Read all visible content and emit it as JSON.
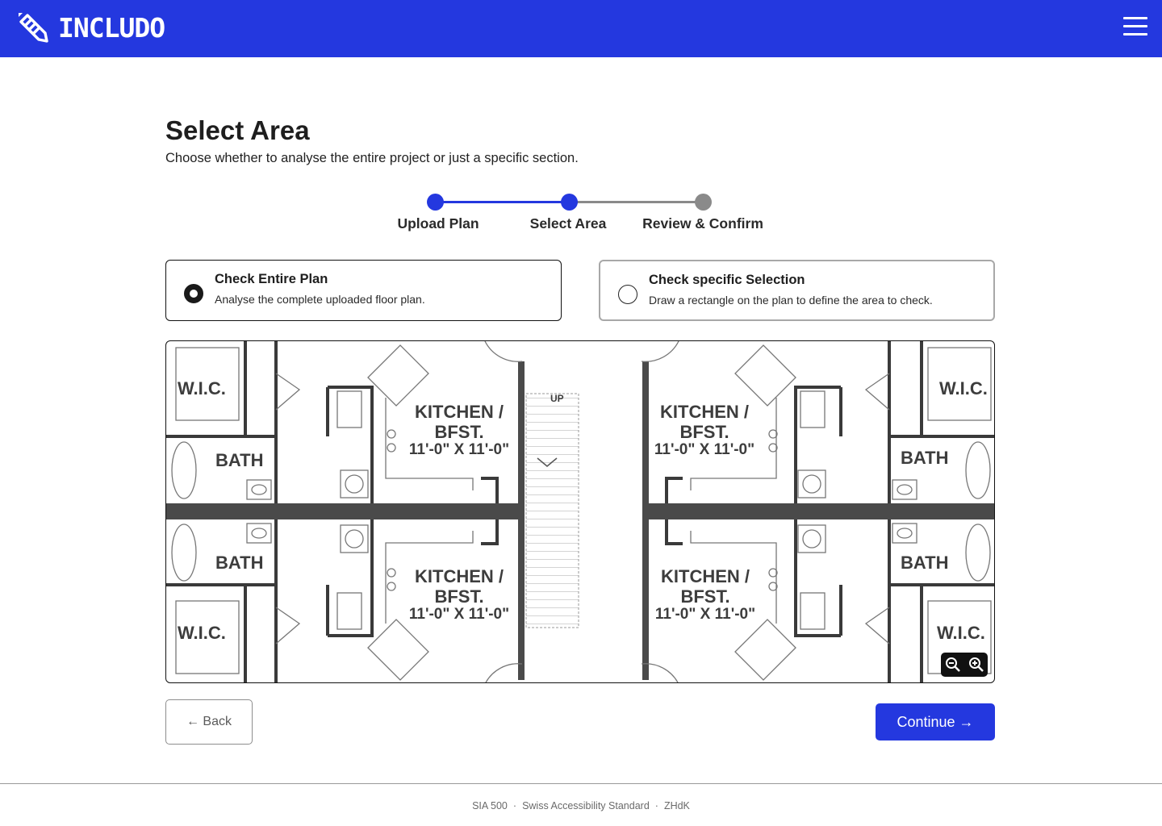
{
  "header": {
    "logo_text": "INCLUDO",
    "menu_icon": "hamburger-menu-icon",
    "background": "#2438df"
  },
  "page": {
    "title": "Select Area",
    "subtitle": "Choose whether to analyse the entire project or just a specific section."
  },
  "stepper": {
    "steps": [
      {
        "label": "Upload Plan",
        "state": "complete"
      },
      {
        "label": "Select Area",
        "state": "current"
      },
      {
        "label": "Review & Confirm",
        "state": "upcoming"
      }
    ],
    "active_color": "#2438df",
    "inactive_color": "#8a8a8a"
  },
  "options": [
    {
      "title": "Check Entire Plan",
      "description": "Analyse the complete uploaded floor plan.",
      "selected": true
    },
    {
      "title": "Check specific Selection",
      "description": "Draw a rectangle on the plan to define the area to check.",
      "selected": false
    }
  ],
  "plan": {
    "labels": {
      "wic": "W.I.C.",
      "bath": "BATH",
      "kitchen_1": "KITCHEN /",
      "kitchen_2": "BFST.",
      "kitchen_3": "11'-0\" X 11'-0\"",
      "stair": "UP"
    },
    "zoom_out_icon": "zoom-out-icon",
    "zoom_in_icon": "zoom-in-icon"
  },
  "actions": {
    "back_label": "← Back",
    "continue_label": "Continue →"
  },
  "footer": {
    "items": [
      "SIA 500",
      "Swiss Accessibility Standard",
      "ZHdK"
    ]
  }
}
